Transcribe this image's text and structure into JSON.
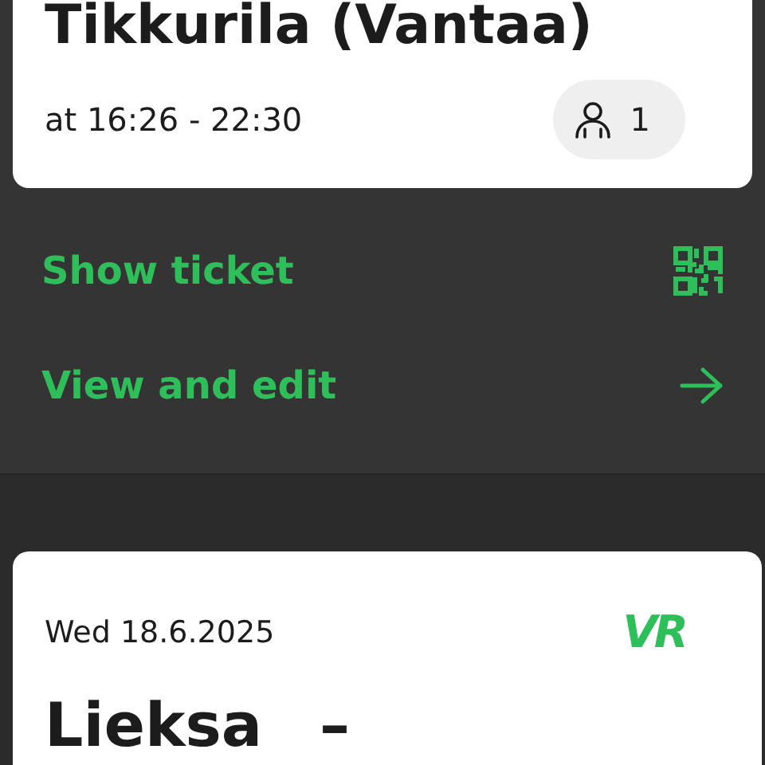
{
  "ticket": {
    "destination": "Tikkurila (Vantaa)",
    "validity": "at 16:26 - 22:30",
    "passengers": "1"
  },
  "actions": [
    {
      "kind": "qr",
      "label": "Show ticket"
    },
    {
      "kind": "arrow",
      "label": "View and edit"
    }
  ],
  "next_ticket": {
    "date": "Wed 18.6.2025",
    "logo": "VR",
    "destination": "Lieksa",
    "dash": "–"
  }
}
